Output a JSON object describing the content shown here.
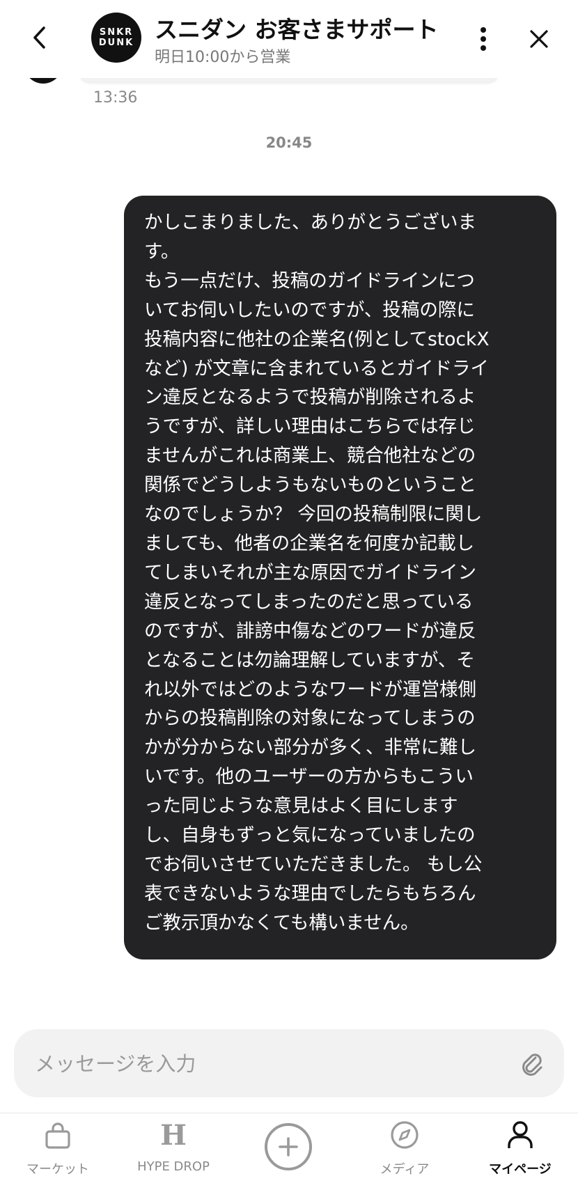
{
  "header": {
    "logo_line1": "SNKR",
    "logo_line2": "DUNK",
    "title": "スニダン お客さまサポート",
    "subtitle": "明日10:00から営業",
    "back_icon": "chevron-left-icon",
    "menu_icon": "more-vertical-icon",
    "close_icon": "close-icon"
  },
  "chat": {
    "prev_time": "13:36",
    "date_separator": "20:45",
    "message": "かしこまりました、ありがとうございま\nす。\nもう一点だけ、投稿のガイドラインにつ\nいてお伺いしたいのですが、投稿の際に\n投稿内容に他社の企業名(例としてstockX\nなど) が文章に含まれているとガイドライ\nン違反となるようで投稿が削除されるよ\nうですが、詳しい理由はこちらでは存じ\nませんがこれは商業上、競合他社などの\n関係でどうしようもないものということ\nなのでしょうか？ 今回の投稿制限に関し\nましても、他者の企業名を何度か記載し\nてしまいそれが主な原因でガイドライン\n違反となってしまったのだと思っている\nのですが、誹謗中傷などのワードが違反\nとなることは勿論理解していますが、そ\nれ以外ではどのようなワードが運営様側\nからの投稿削除の対象になってしまうの\nかが分からない部分が多く、非常に難し\nいです。他のユーザーの方からもこうい\nった同じような意見はよく目にします\nし、自身もずっと気になっていましたの\nでお伺いさせていただきました。 もし公\n表できないような理由でしたらもちろん\nご教示頂かなくても構いません。"
  },
  "composer": {
    "placeholder": "メッセージを入力",
    "value": "",
    "attach_icon": "paperclip-icon"
  },
  "tabs": [
    {
      "label": "マーケット",
      "icon": "shopping-bag-icon",
      "active": false
    },
    {
      "label": "HYPE DROP",
      "icon": "hype-drop-icon",
      "active": false
    },
    {
      "label": "",
      "icon": "plus-circle-icon",
      "active": false
    },
    {
      "label": "メディア",
      "icon": "compass-icon",
      "active": false
    },
    {
      "label": "マイページ",
      "icon": "person-icon",
      "active": true
    }
  ],
  "colors": {
    "bubble_bg": "#232325",
    "composer_bg": "#f2f2f2",
    "active_tab": "#111111",
    "inactive_tab": "#8a8a8a"
  }
}
